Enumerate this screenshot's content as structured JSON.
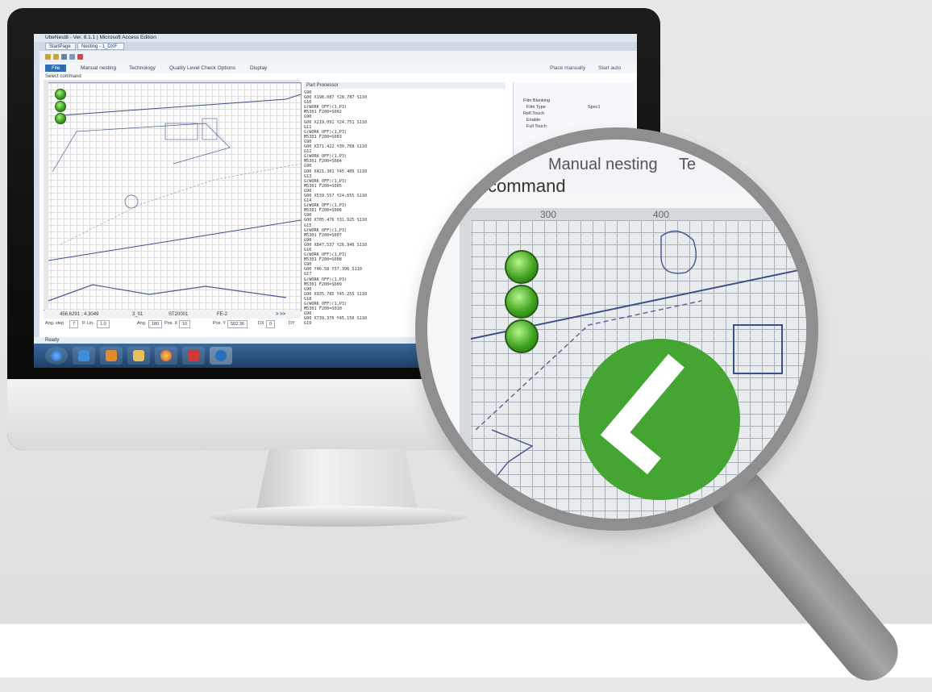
{
  "app": {
    "title": "UbeNest8 - Ver. 8.1.1 | Microsoft Access Edition",
    "tabs": [
      "StartPage",
      "Nesting - 1_DXF"
    ],
    "ribbon_tabs": [
      "File",
      "Manual nesting",
      "Technology",
      "Quality Level Check Options",
      "Display"
    ],
    "command_prompt": "Select command",
    "part_processor_title": "Part Processor",
    "status": "Ready"
  },
  "coords": {
    "position": "456.6291 ; 4.3049",
    "c1": "3_01",
    "c2": "ST20001",
    "c3": "FE-2",
    "next": "> >>"
  },
  "inputs": {
    "ang_step_label": "Ang. step",
    "ang_step": "7",
    "p_lin_label": "P. Lin.",
    "p_lin": "1.0",
    "ang_label": "Ang.",
    "ang": "180",
    "pos_x_label": "Pos. X",
    "pos_x": "10",
    "pos_y_label": "Pos. Y",
    "pos_y": "502.36",
    "dx_label": "DX",
    "dx": "0",
    "dy_label": "DY"
  },
  "right_panel": {
    "items": [
      "Film Blanking",
      "Film Type",
      "Spec1",
      "Refl.Touch",
      "Enable",
      "Full Touch"
    ],
    "buttons": [
      "Place manually",
      "Start auto"
    ]
  },
  "code_lines": [
    "G90",
    "G00 X198.087 Y28.787 S110",
    "G10",
    "G(WORK_OFF)(1,P3)",
    "M5301 F200=S002",
    "G90",
    "G00 X219.091 Y24.751 S110",
    "G11",
    "G(WORK_OFF)(1,P3)",
    "M5301 F200=S003",
    "G90",
    "G00 X371.422 Y30.708 S110",
    "G12",
    "G(WORK_OFF)(1,P3)",
    "M5301 F200=S004",
    "G90",
    "G00 X421.301 Y45.405 S110",
    "G13",
    "G(WORK_OFF)(1,P3)",
    "M5301 F200=S005",
    "G90",
    "G00 X539.557 Y24.655 S110",
    "G14",
    "G(WORK_OFF)(1,P3)",
    "M5301 F200=S006",
    "G90",
    "G00 X705.476 Y31.925 S110",
    "G15",
    "G(WORK_OFF)(1,P3)",
    "M5301 F200=S007",
    "G90",
    "G00 X847.537 Y26.946 S110",
    "G16",
    "G(WORK_OFF)(1,P3)",
    "M5301 F200=S008",
    "G90",
    "G00 Y46.58 Y37.396 S110",
    "G17",
    "G(WORK_OFF)(1,P3)",
    "M5301 F200=S009",
    "G90",
    "G00 X935.785 Y45.255 S110",
    "G18",
    "G(WORK_OFF)(1,P3)",
    "M5301 F200=S010",
    "G90",
    "G00 X739.376 Y45.156 S110",
    "G19"
  ],
  "zoom": {
    "tab_manual": "Manual nesting",
    "tab_next": "Te",
    "command": "command",
    "ruler": [
      "300",
      "400"
    ]
  },
  "colors": {
    "accent": "#2e6db4",
    "check": "#45a533",
    "led": "#3ea11e"
  }
}
